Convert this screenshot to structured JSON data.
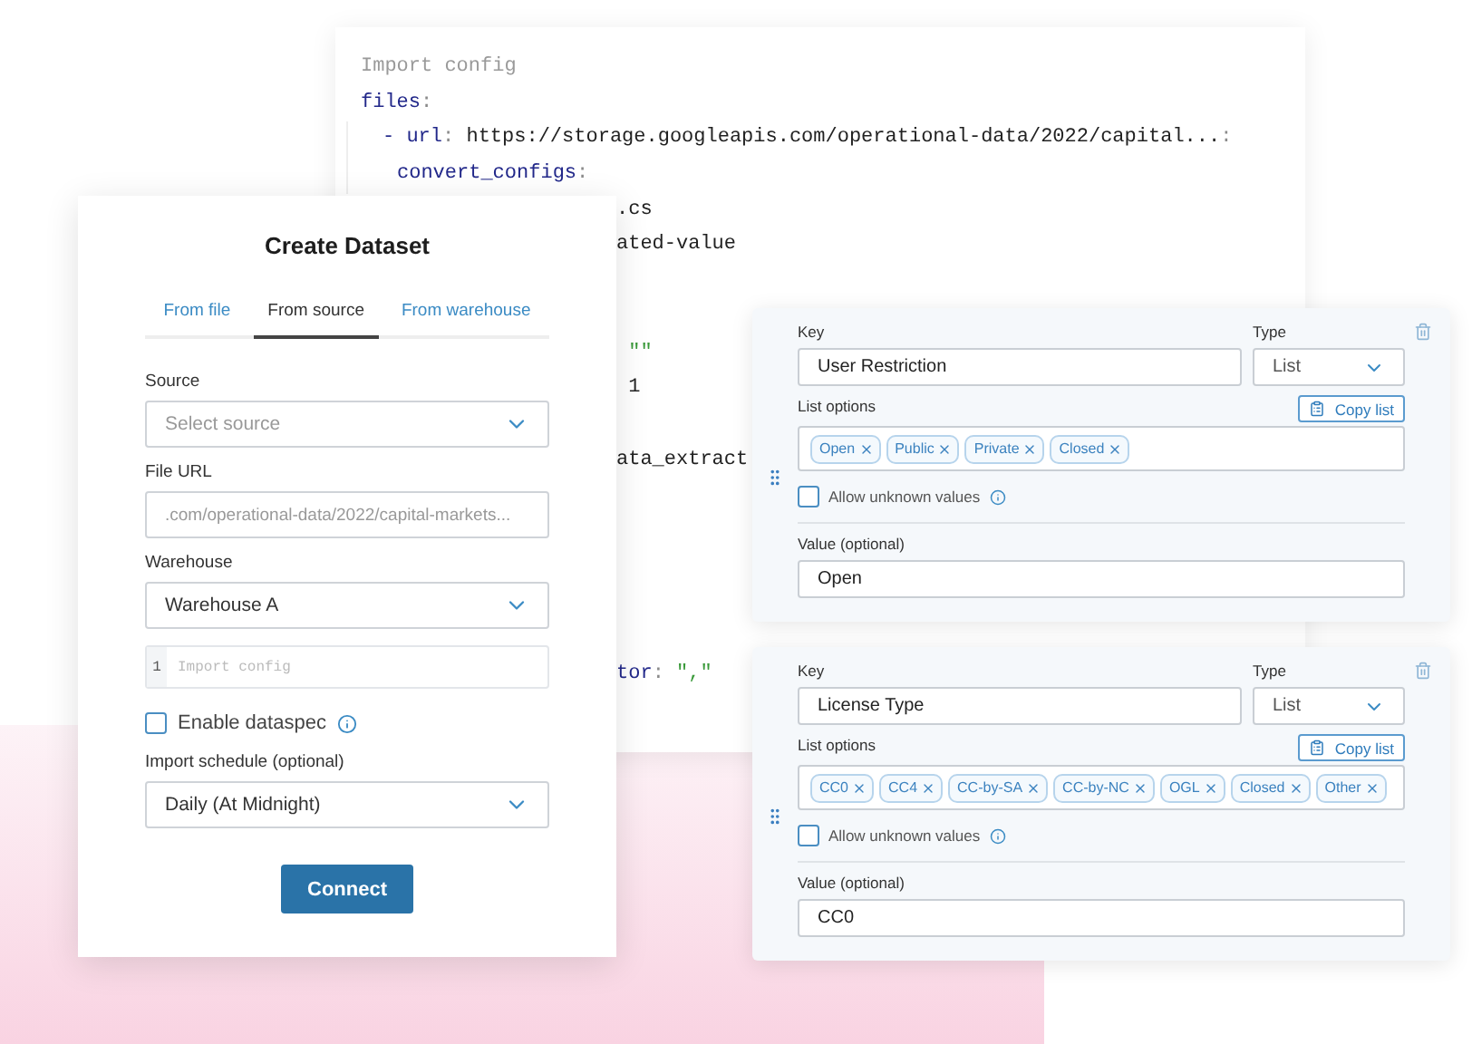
{
  "code_editor": {
    "lines": [
      {
        "kind": "full",
        "segments": [
          {
            "kind": "comment",
            "text": "Import config"
          }
        ]
      },
      {
        "kind": "full",
        "segments": [
          {
            "kind": "key",
            "text": "files"
          },
          {
            "kind": "punct",
            "text": ":"
          }
        ],
        "children": [
          {
            "segments": [
              {
                "kind": "key",
                "text": "- url"
              },
              {
                "kind": "punct",
                "text": ":"
              },
              {
                "kind": "text",
                "text": " https://storage.googleapis.com/operational-data/2022/capital..."
              },
              {
                "kind": "punct",
                "text": ":"
              }
            ],
            "children": [
              {
                "segments": [
                  {
                    "kind": "key",
                    "text": "convert_configs"
                  },
                  {
                    "kind": "punct",
                    "text": ":"
                  }
                ]
              }
            ]
          }
        ]
      },
      {
        "kind": "partial",
        "segments": [
          {
            "kind": "text",
            "text": ".cs"
          }
        ]
      },
      {
        "kind": "partial",
        "segments": [
          {
            "kind": "text",
            "text": "ated-value"
          }
        ]
      },
      {
        "kind": "hidden"
      },
      {
        "kind": "hidden"
      },
      {
        "kind": "partial",
        "segments": [
          {
            "kind": "string",
            "text": " \"\""
          }
        ]
      },
      {
        "kind": "partial",
        "segments": [
          {
            "kind": "text",
            "text": " 1"
          }
        ]
      },
      {
        "kind": "hidden"
      },
      {
        "kind": "partial",
        "segments": [
          {
            "kind": "text",
            "text": "ata_extract"
          }
        ]
      },
      {
        "kind": "hidden"
      },
      {
        "kind": "hidden"
      },
      {
        "kind": "hidden"
      },
      {
        "kind": "hidden"
      },
      {
        "kind": "hidden"
      },
      {
        "kind": "partial",
        "segments": [
          {
            "kind": "key",
            "text": "tor"
          },
          {
            "kind": "punct",
            "text": ":"
          },
          {
            "kind": "string",
            "text": " \",\""
          }
        ]
      }
    ]
  },
  "dialog": {
    "title": "Create Dataset",
    "tabs": [
      {
        "label": "From file",
        "selected": false
      },
      {
        "label": "From source",
        "selected": true
      },
      {
        "label": "From warehouse",
        "selected": false
      }
    ],
    "fields": [
      {
        "kind": "select",
        "label": "Source",
        "placeholder": "Select source"
      },
      {
        "kind": "input",
        "label": "File URL",
        "placeholder": ".com/operational-data/2022/capital-markets..."
      },
      {
        "kind": "select",
        "label": "Warehouse",
        "value": "Warehouse A"
      },
      {
        "kind": "code",
        "line_number": "1",
        "placeholder": "Import config"
      },
      {
        "kind": "checkbox",
        "label": "Enable dataspec",
        "checked": false
      },
      {
        "kind": "select",
        "label": "Import schedule (optional)",
        "value": "Daily (At Midnight)"
      }
    ],
    "button": "Connect"
  },
  "cards": [
    {
      "key_label": "Key",
      "key": "User Restriction",
      "type_label": "Type",
      "type": "List",
      "options_label": "List options",
      "copy_button": "Copy list",
      "options": [
        "Open",
        "Public",
        "Private",
        "Closed"
      ],
      "allow_unknown": {
        "label": "Allow unknown values",
        "checked": false
      },
      "value_label": "Value (optional)",
      "value": "Open"
    },
    {
      "key_label": "Key",
      "key": "License Type",
      "type_label": "Type",
      "type": "List",
      "options_label": "List options",
      "copy_button": "Copy list",
      "options": [
        "CC0",
        "CC4",
        "CC-by-SA",
        "CC-by-NC",
        "OGL",
        "Closed",
        "Other"
      ],
      "allow_unknown": {
        "label": "Allow unknown values",
        "checked": false
      },
      "value_label": "Value (optional)",
      "value": "CC0"
    }
  ]
}
